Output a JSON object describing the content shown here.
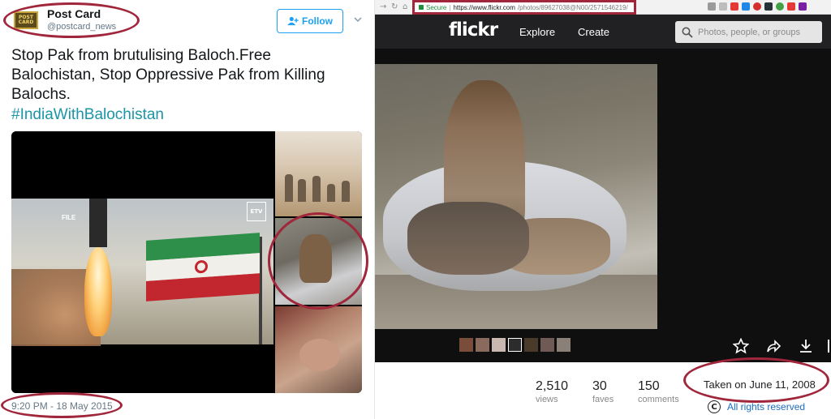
{
  "tweet": {
    "avatar_text": "POST CARD",
    "display_name": "Post Card",
    "handle": "@postcard_news",
    "follow_label": "Follow",
    "text": "Stop Pak from brutulising Baloch.Free Balochistan, Stop Oppressive Pak from Killing Balochs.",
    "hashtag": "#IndiaWithBalochistan",
    "timestamp": "9:20 PM - 18 May 2015",
    "video_overlay": "FILE",
    "channel_logo": "ETV"
  },
  "browser": {
    "secure_label": "Secure",
    "url_host": "https://www.flickr.com",
    "url_path": "/photos/89627038@N00/2571546219/"
  },
  "flickr": {
    "logo": "flickr",
    "nav": [
      "Explore",
      "Create"
    ],
    "search_placeholder": "Photos, people, or groups",
    "stats": [
      {
        "value": "2,510",
        "label": "views"
      },
      {
        "value": "30",
        "label": "faves"
      },
      {
        "value": "150",
        "label": "comments"
      }
    ],
    "taken": "Taken on June 11, 2008",
    "rights_symbol": "C",
    "rights": "All rights reserved",
    "filmstrip_colors": [
      "#7a4c3a",
      "#8a6a5c",
      "#c9b8b0",
      "#2c2c2c",
      "#4a3a2a",
      "#6f5a55",
      "#8b8078"
    ]
  },
  "colors": {
    "annotation_ring": "#a0263b",
    "twitter_blue": "#1da1f2",
    "hashtag": "#1b95a8",
    "flickr_bar": "#212124"
  }
}
